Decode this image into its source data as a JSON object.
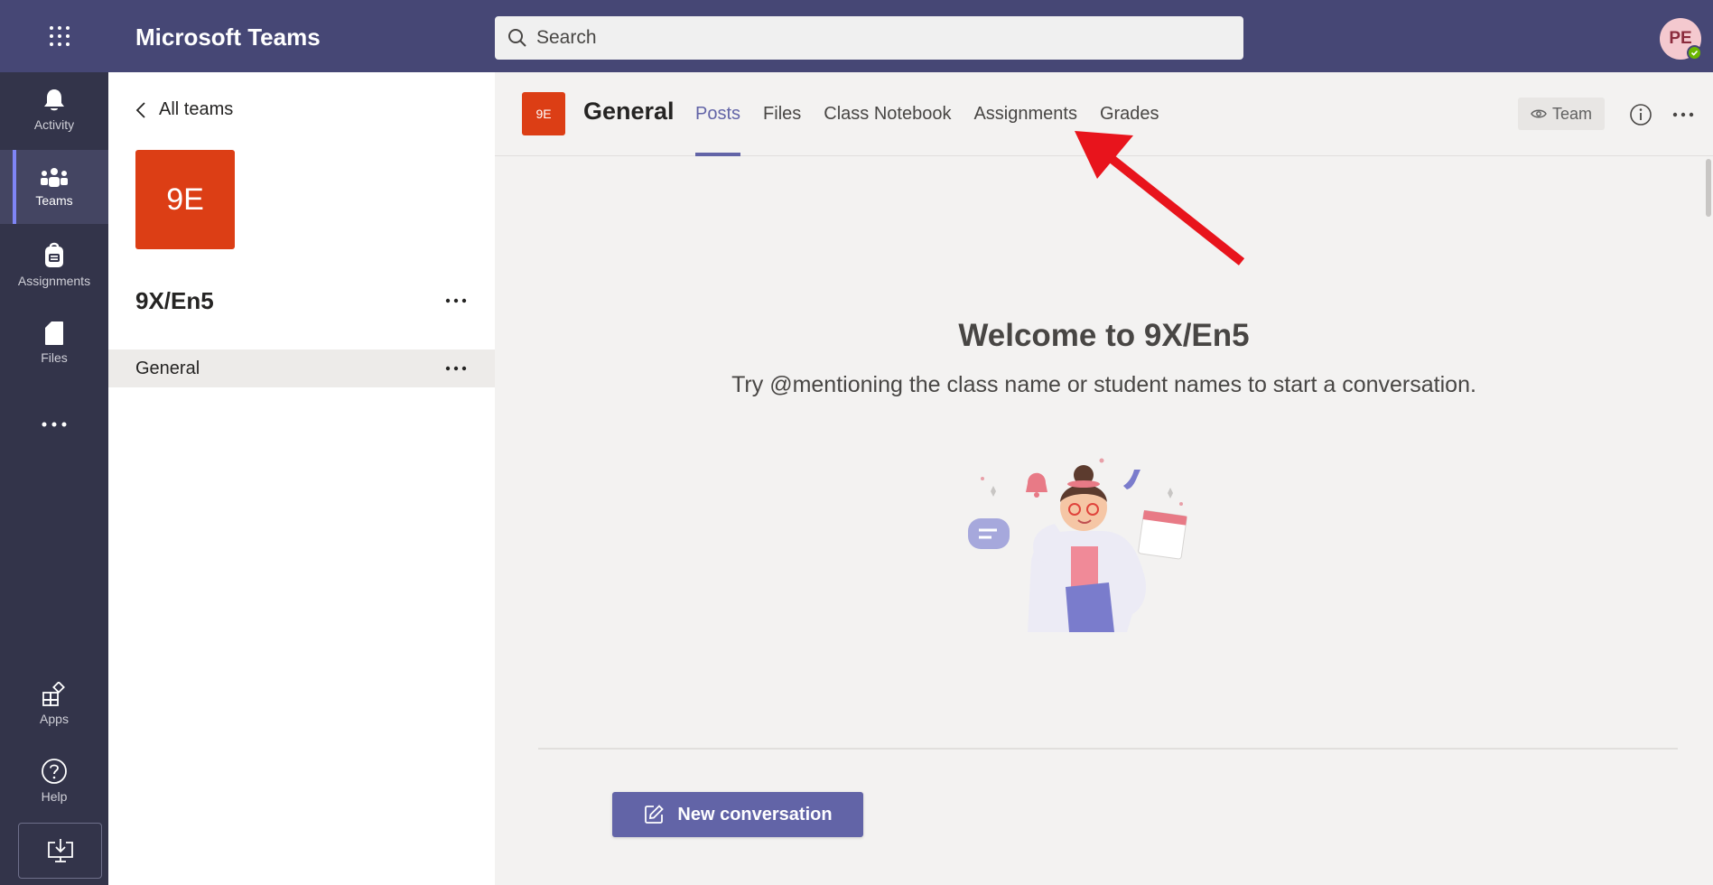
{
  "topbar": {
    "app_title": "Microsoft Teams",
    "search_placeholder": "Search",
    "avatar_initials": "PE"
  },
  "rail": {
    "items": [
      {
        "label": "Activity",
        "icon": "bell-icon"
      },
      {
        "label": "Teams",
        "icon": "teams-icon"
      },
      {
        "label": "Assignments",
        "icon": "assignments-bag-icon"
      },
      {
        "label": "Files",
        "icon": "file-icon"
      }
    ],
    "apps_label": "Apps",
    "help_label": "Help",
    "active": "Teams"
  },
  "panel": {
    "back_label": "All teams",
    "team_tile_text": "9E",
    "team_name": "9X/En5",
    "channels": [
      {
        "label": "General",
        "selected": true
      }
    ]
  },
  "channel": {
    "tile_text": "9E",
    "title": "General",
    "tabs": [
      {
        "label": "Posts",
        "active": true
      },
      {
        "label": "Files",
        "active": false
      },
      {
        "label": "Class Notebook",
        "active": false
      },
      {
        "label": "Assignments",
        "active": false
      },
      {
        "label": "Grades",
        "active": false
      }
    ],
    "team_button_label": "Team"
  },
  "main": {
    "welcome_title": "Welcome to 9X/En5",
    "welcome_hint": "Try @mentioning the class name or student names to start a conversation.",
    "new_conversation_label": "New conversation"
  },
  "colors": {
    "brand": "#464775",
    "accent": "#6264a7",
    "rail_bg": "#33344a",
    "team_tile": "#dc3e15",
    "annotation_arrow": "#e8141c"
  }
}
